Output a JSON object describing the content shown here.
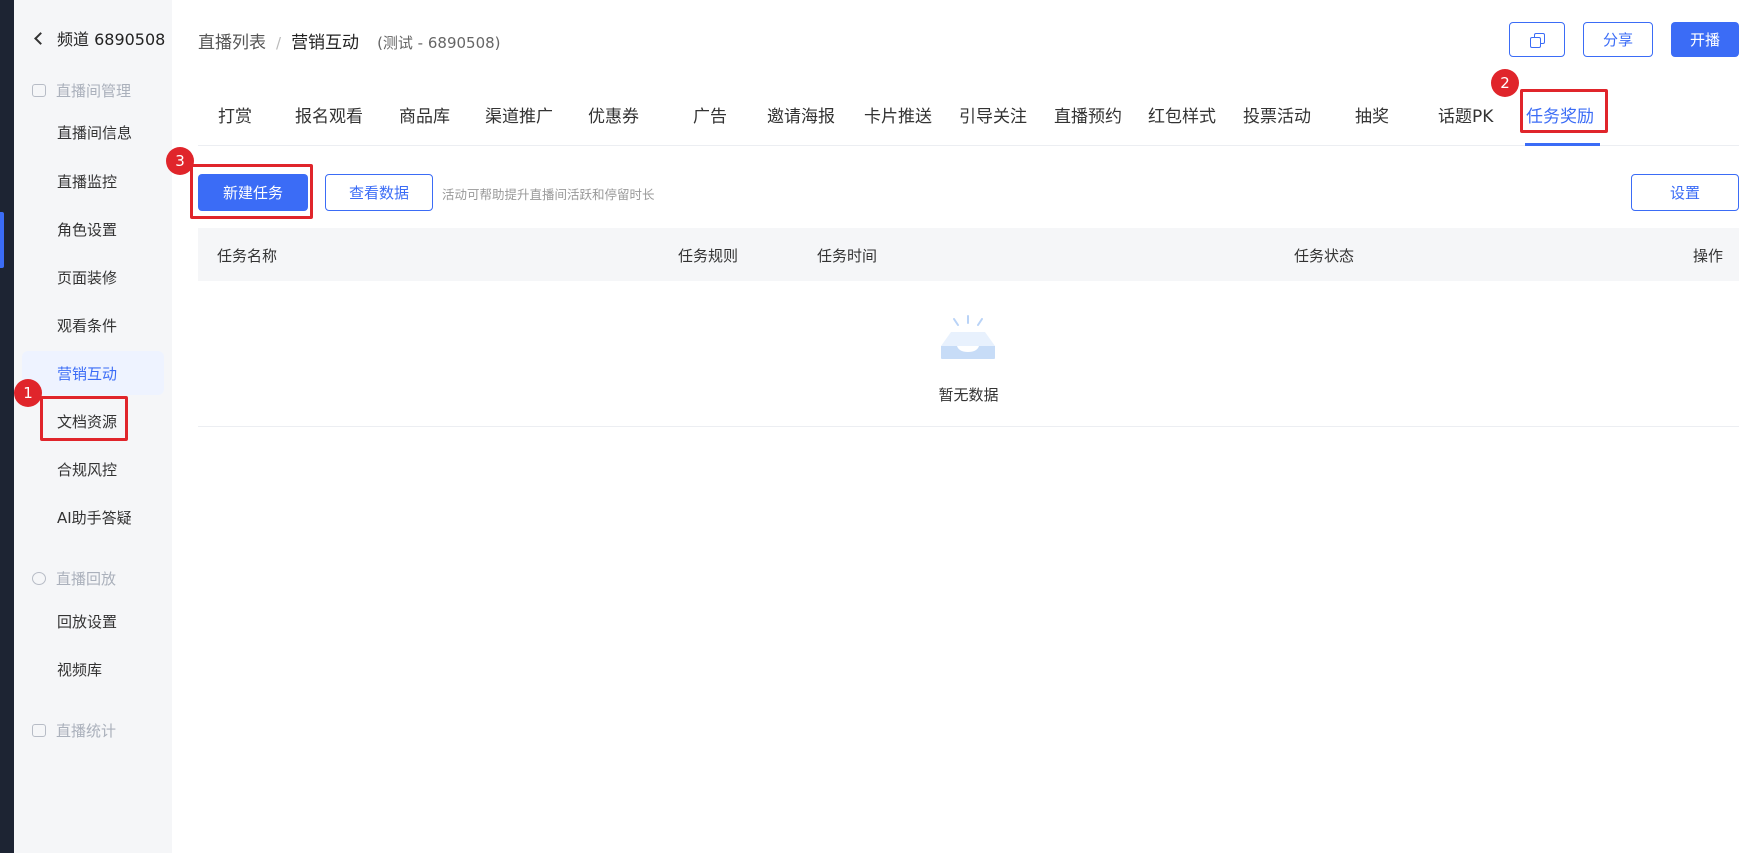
{
  "sidebar": {
    "back_title": "频道 6890508",
    "group_manage": "直播间管理",
    "items_manage": [
      "直播间信息",
      "直播监控",
      "角色设置",
      "页面装修",
      "观看条件",
      "营销互动",
      "文档资源",
      "合规风控",
      "AI助手答疑"
    ],
    "group_replay": "直播回放",
    "items_replay": [
      "回放设置",
      "视频库"
    ],
    "group_stats": "直播统计",
    "active_item": "营销互动"
  },
  "breadcrumb": {
    "root": "直播列表",
    "separator": "/",
    "current": "营销互动",
    "subtitle": "(测试 - 6890508)"
  },
  "header_buttons": {
    "share": "分享",
    "start": "开播",
    "copy_icon": "copy-icon"
  },
  "tabs": [
    "打赏",
    "报名观看",
    "商品库",
    "渠道推广",
    "优惠券",
    "广告",
    "邀请海报",
    "卡片推送",
    "引导关注",
    "直播预约",
    "红包样式",
    "投票活动",
    "抽奖",
    "话题PK",
    "任务奖励"
  ],
  "active_tab": "任务奖励",
  "toolbar": {
    "new_task": "新建任务",
    "view_data": "查看数据",
    "hint": "活动可帮助提升直播间活跃和停留时长",
    "settings": "设置"
  },
  "table": {
    "columns": [
      "任务名称",
      "任务规则",
      "任务时间",
      "任务状态",
      "操作"
    ],
    "empty_text": "暂无数据"
  },
  "annotations": [
    "1",
    "2",
    "3"
  ],
  "colors": {
    "accent": "#3b6cf6",
    "highlight": "#e0252b",
    "sidebar_bg": "#f5f6f8"
  }
}
